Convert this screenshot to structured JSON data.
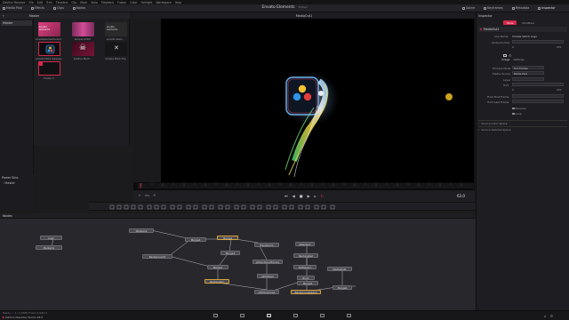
{
  "app": {
    "menu": [
      "DaVinci Resolve",
      "File",
      "Edit",
      "Trim",
      "Timeline",
      "Clip",
      "Mark",
      "View",
      "Playback",
      "Fusion",
      "Color",
      "Fairlight",
      "Workspace",
      "Help"
    ],
    "project_title": "Envato Elements",
    "project_status": "Edited"
  },
  "toolbar": {
    "left_buttons": [
      "Media Pool",
      "Effects",
      "Clips",
      "Nodes"
    ],
    "right_buttons": [
      "Spline",
      "Keyframes",
      "Metadata",
      "Inspector"
    ]
  },
  "media_pool": {
    "bin_title": "Master",
    "bins": [
      "Master"
    ],
    "power_bins_title": "Power Bins",
    "power_bins": [
      "Master"
    ],
    "clips": [
      {
        "label": "envatoelements-ann...",
        "color": "#d23c7a"
      },
      {
        "label": "Simple Glitch",
        "color": "#b33d8a"
      },
      {
        "label": "envato elem...",
        "color": "#2a2a2a"
      },
      {
        "label": "envato Mark Sweeps...",
        "color": "#101014"
      },
      {
        "label": "Outline Mark...",
        "color": "#2a0a14"
      },
      {
        "label": "Simple Mark Flip",
        "color": "#161618"
      },
      {
        "label": "Fusion 1",
        "color": "#111114"
      }
    ]
  },
  "viewer": {
    "title": "MediaOut1",
    "timecode": "63.0"
  },
  "inspector": {
    "title": "Inspector",
    "tabs": [
      "Tools",
      "Modifiers"
    ],
    "node_name": "MediaOut1",
    "clip_name_label": "Clip Name",
    "clip_name_value": "Simple Glitch Logo",
    "global_in_out_label": "Global In/Out",
    "global_in": "0",
    "global_out": "251",
    "sub_tabs": [
      "Image",
      "Settings"
    ],
    "fields": [
      {
        "label": "Process Mode",
        "value": "Full Frames"
      },
      {
        "label": "Media Source",
        "value": "Media Pool"
      }
    ],
    "layer_label": "Layer",
    "trim_label": "Trim",
    "trim_in": "0",
    "trim_out": "251",
    "hold_first_label": "Hold First Frame",
    "hold_last_label": "Hold Last Frame",
    "reverse_label": "Reverse",
    "loop_label": "Loop",
    "sections": [
      "Source Color Space",
      "Source Gamma Space"
    ]
  },
  "nodes": {
    "title": "Nodes",
    "items": [
      "Logo",
      "MediaIn1",
      "MediaIn2",
      "Background1",
      "Merge4",
      "Merge2",
      "Merge3",
      "Merge1",
      "Rectangle1",
      "Transform1",
      "pEmitter1",
      "pDirectionalForce1",
      "pTurbulence1",
      "pRender1",
      "Rectangle2",
      "MediaOut1",
      "Blur1",
      "SoftGlow1",
      "Merge5",
      "BackgroundGlitch",
      "Merge6"
    ]
  },
  "statusbar": {
    "left": "Ready — 1 / 1 [NVE]   Frame 1/GPU 1",
    "product": "DaVinci Resolve Studio 18.6"
  },
  "colors": {
    "accent": "#d8a23a",
    "selection_red": "#d6284a",
    "viewer_bg": "#000000"
  }
}
